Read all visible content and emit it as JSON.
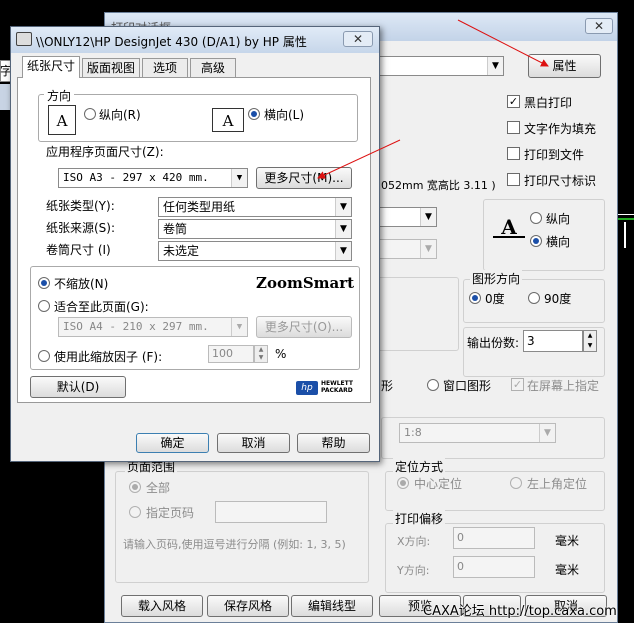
{
  "back_dialog": {
    "title": "打印对话框",
    "properties_button": "属性",
    "checkboxes": [
      {
        "label": "黑白打印",
        "checked": true
      },
      {
        "label": "文字作为填充",
        "checked": false
      },
      {
        "label": "打印到文件",
        "checked": false
      },
      {
        "label": "打印尺寸标识",
        "checked": false
      }
    ],
    "paper_size_text": "052mm 宽高比 3.11 )",
    "orientation": {
      "portrait": "纵向",
      "landscape": "横向",
      "icon_letter": "A"
    },
    "shape_direction": {
      "title": "图形方向",
      "deg0": "0度",
      "deg90": "90度"
    },
    "copies": {
      "label": "输出份数:",
      "value": "3"
    },
    "area_tail": "形",
    "window_shape": "窗口图形",
    "screen_specify": "在屏幕上指定",
    "scale_value": "1:8",
    "page_range": {
      "title": "页面范围",
      "all": "全部",
      "specify": "指定页码",
      "hint": "请输入页码,使用逗号进行分隔  (例如: 1, 3, 5)"
    },
    "position": {
      "title": "定位方式",
      "center": "中心定位",
      "top_left": "左上角定位"
    },
    "offset": {
      "title": "打印偏移",
      "x_label": "X方向:",
      "x_value": "0",
      "y_label": "Y方向:",
      "y_value": "0",
      "unit": "毫米"
    },
    "bottom_buttons": [
      "载入风格",
      "保存风格",
      "编辑线型",
      "预览",
      "取消"
    ],
    "watermark": "CAXA论坛 http://top.caxa.com"
  },
  "front_dialog": {
    "title": "\\\\ONLY12\\HP DesignJet 430 (D/A1) by HP 属性",
    "tabs": [
      "纸张尺寸",
      "版面视图",
      "选项",
      "高级"
    ],
    "orientation": {
      "title": "方向",
      "portrait": "纵向(R)",
      "landscape": "横向(L)",
      "icon_letter": "A"
    },
    "app_page_size_label": "应用程序页面尺寸(Z):",
    "app_page_size_value": "ISO A3 - 297 x 420 mm.",
    "more_sizes_button": "更多尺寸(M)...",
    "paper_type_label": "纸张类型(Y):",
    "paper_type_value": "任何类型用纸",
    "paper_source_label": "纸张来源(S):",
    "paper_source_value": "卷筒",
    "roll_size_label": "卷筒尺寸 (I)",
    "roll_size_value": "未选定",
    "scaling": {
      "no_scale": "不缩放(N)",
      "fit_page": "适合至此页面(G):",
      "fit_page_value": "ISO A4 - 210 x 297 mm.",
      "more_sizes": "更多尺寸(O)...",
      "use_factor": "使用此缩放因子 (F):",
      "factor_value": "100",
      "percent": "%",
      "zoomsmart": "ZoomSmart"
    },
    "default_button": "默认(D)",
    "hp_logo_text": "hp",
    "hp_brand_line1": "HEWLETT",
    "hp_brand_line2": "PACKARD",
    "ok_button": "确定",
    "cancel_button": "取消",
    "help_button": "帮助"
  },
  "colors": {
    "annotation_arrow": "#dd1111",
    "dialog_bg": "#f0f0f0",
    "title_bar": "#c9d8ec",
    "accent": "#1b4fa8"
  }
}
